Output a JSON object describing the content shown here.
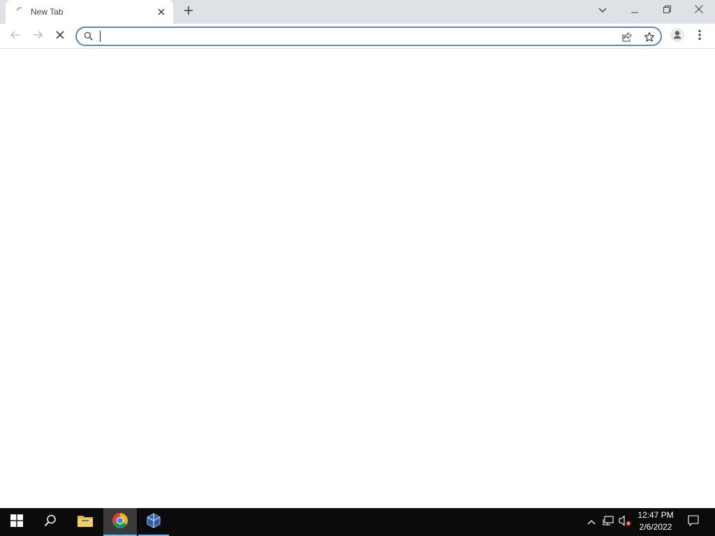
{
  "tab": {
    "title": "New Tab"
  },
  "omnibox": {
    "value": "",
    "placeholder": ""
  },
  "icons": {
    "tab_loading": "loading-spinner-icon",
    "tab_close": "close-icon",
    "new_tab": "plus-icon",
    "tab_search": "chevron-down-icon",
    "minimize": "minimize-icon",
    "restore": "restore-icon",
    "window_close": "close-icon",
    "back": "arrow-left-icon",
    "forward": "arrow-right-icon",
    "stop": "close-icon",
    "search": "search-icon",
    "share": "share-icon",
    "bookmark": "star-icon",
    "profile": "profile-icon",
    "menu": "kebab-menu-icon",
    "start": "windows-icon",
    "taskbar_search": "search-icon",
    "file_explorer": "folder-icon",
    "chrome": "chrome-icon",
    "virtualbox": "cube-icon",
    "tray_overflow": "chevron-up-icon",
    "network": "network-icon",
    "volume": "volume-muted-icon",
    "notifications": "notification-icon"
  },
  "colors": {
    "tabstrip_bg": "#dee1e6",
    "omnibox_border": "#5e86c7",
    "taskbar_bg": "#0b0b0b",
    "taskbar_active": "#3a3a3a",
    "taskbar_underline": "#76b9ed"
  },
  "taskbar": {
    "time": "12:47 PM",
    "date": "2/6/2022"
  }
}
